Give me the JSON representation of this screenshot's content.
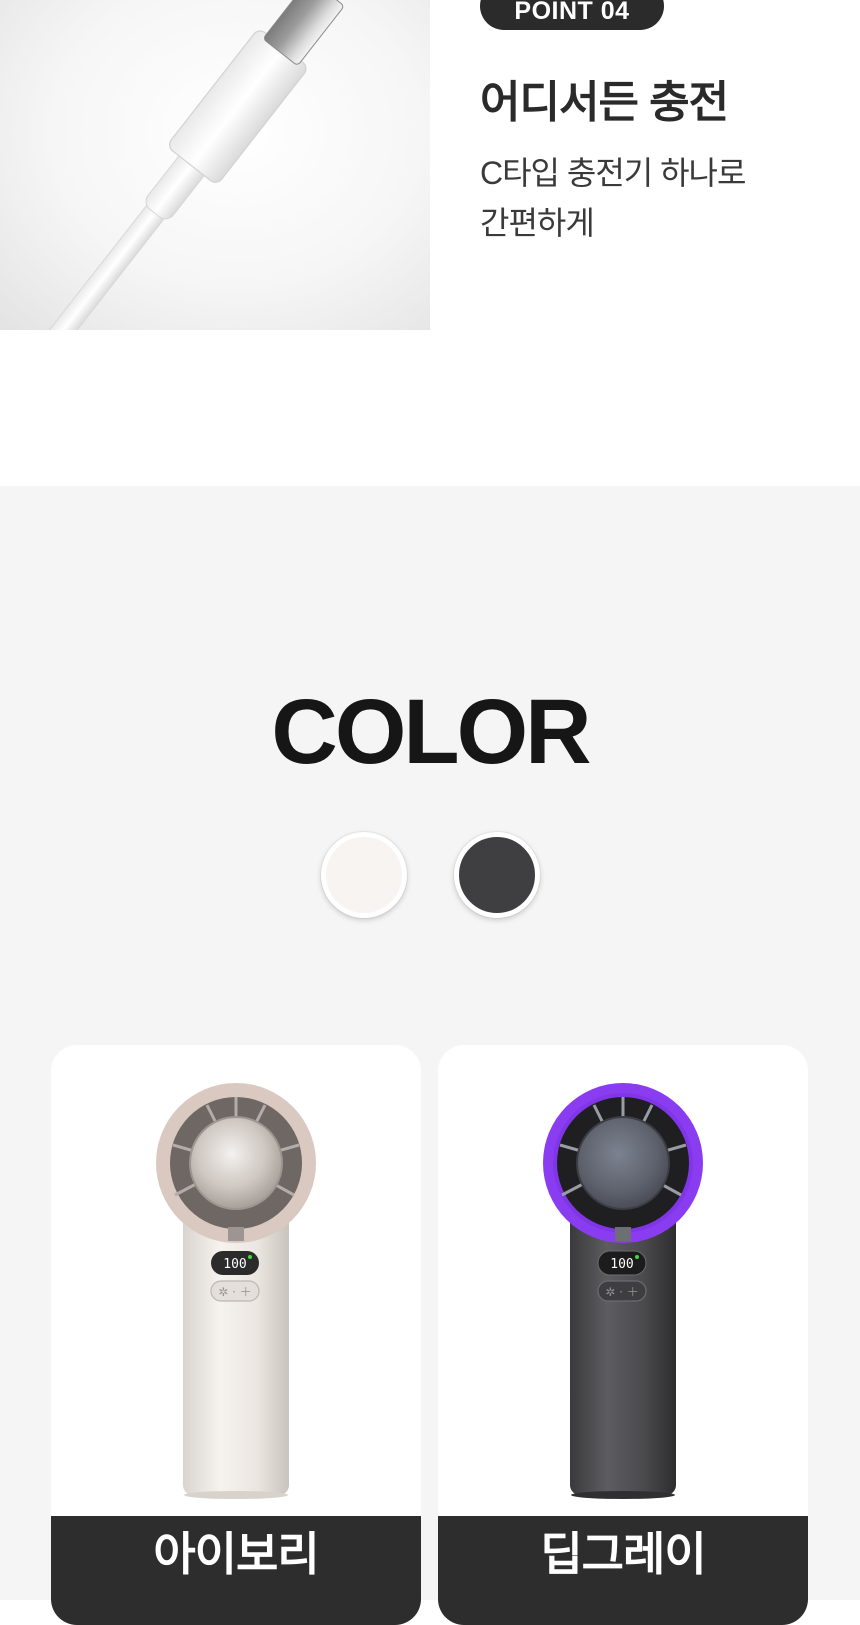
{
  "feature": {
    "badge": "POINT 04",
    "title": "어디서든 충전",
    "desc_line1": "C타입 충전기 하나로",
    "desc_line2": "간편하게",
    "photo_icon": "usb-c-cable-photo"
  },
  "colors": {
    "title": "COLOR",
    "swatches": [
      {
        "name": "ivory",
        "hex": "#f8f4f1"
      },
      {
        "name": "deep-gray",
        "hex": "#3f3f41"
      }
    ],
    "products": [
      {
        "label": "아이보리",
        "display": "100",
        "accent": "#d8c7bf"
      },
      {
        "label": "딥그레이",
        "display": "100",
        "accent": "#8a3df0"
      }
    ]
  }
}
